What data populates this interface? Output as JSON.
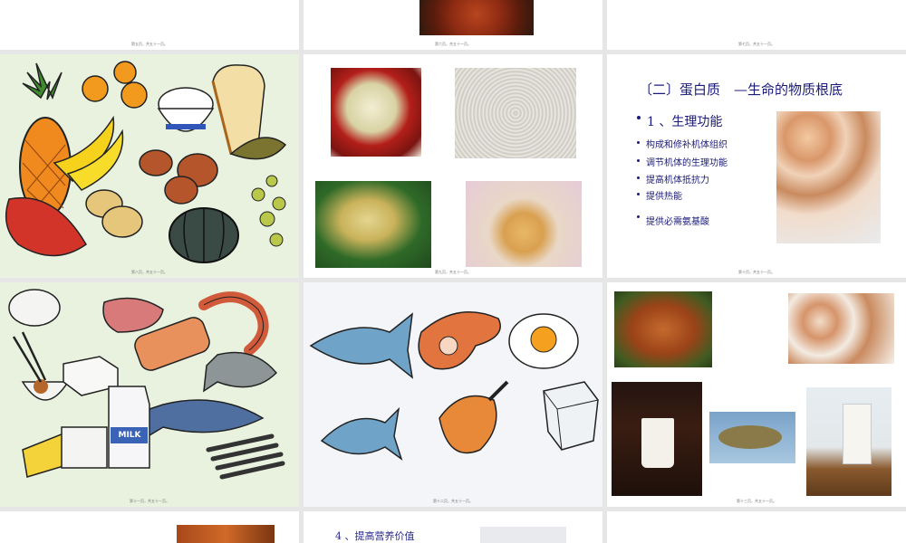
{
  "page_numbers": {
    "s5": "第五页，共五十一页。",
    "s6": "第六页，共五十一页。",
    "s7": "第七页，共五十一页。",
    "s8": "第八页，共五十一页。",
    "s9": "第九页，共五十一页。",
    "s10": "第十页，共五十一页。",
    "s11": "第十一页，共五十一页。",
    "s12": "第十二页，共五十一页。",
    "s13": "第十三页，共五十一页。"
  },
  "protein_slide": {
    "title": "〔二〕蛋白质　—生命的物质根底",
    "heading": "1 、生理功能",
    "bullets": [
      "构成和修补机体组织",
      "调节机体的生理功能",
      "提高机体抵抗力",
      "提供热能",
      "提供必需氨基酸"
    ]
  },
  "bottom_slide": {
    "subheading": "4 、提高营养价值"
  },
  "drawing_labels": {
    "milk": "MILK"
  },
  "colors": {
    "text_navy": "#1a1a7a",
    "gap_gray": "#e6e6e6",
    "drawing_bg_green": "#e9f2df",
    "drawing_bg_blue": "#dde9f5",
    "fish_slide_bg": "#f4f5f8"
  }
}
